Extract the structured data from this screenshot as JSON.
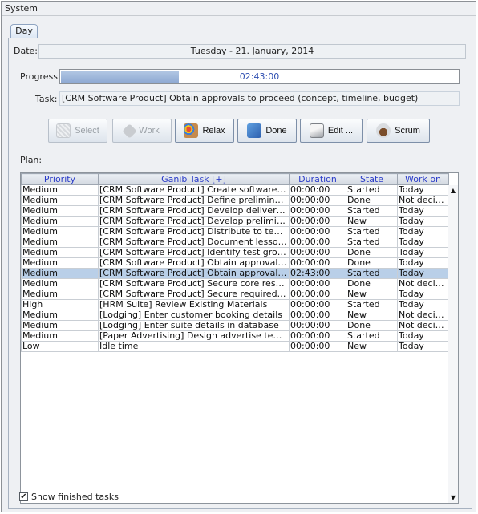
{
  "menu": {
    "system": "System"
  },
  "tab": {
    "label": "Day"
  },
  "date": {
    "label": "Date:",
    "value": "Tuesday - 21. January, 2014"
  },
  "progress": {
    "label": "Progress:",
    "value": "02:43:00",
    "fraction": 0.295
  },
  "task": {
    "label": "Task:",
    "value": "[CRM Software Product] Obtain approvals to proceed (concept, timeline, budget)"
  },
  "buttons": [
    {
      "label": "Select",
      "icon": "select-icon",
      "enabled": false
    },
    {
      "label": "Work",
      "icon": "work-icon",
      "enabled": false
    },
    {
      "label": "Relax",
      "icon": "relax-icon",
      "enabled": true
    },
    {
      "label": "Done",
      "icon": "done-icon",
      "enabled": true
    },
    {
      "label": "Edit ...",
      "icon": "edit-icon",
      "enabled": true
    },
    {
      "label": "Scrum",
      "icon": "scrum-icon",
      "enabled": true
    }
  ],
  "plan": {
    "label": "Plan:"
  },
  "table": {
    "headers": [
      "Priority",
      "Ganib Task [+]",
      "Duration",
      "State",
      "Work on"
    ],
    "rows": [
      [
        "Medium",
        "[CRM Software Product] Create software maintenanc...",
        "00:00:00",
        "Started",
        "Today"
      ],
      [
        "Medium",
        "[CRM Software Product] Define preliminary resources",
        "00:00:00",
        "Done",
        "Not decided"
      ],
      [
        "Medium",
        "[CRM Software Product] Develop delivery timeline",
        "00:00:00",
        "Started",
        "Today"
      ],
      [
        "Medium",
        "[CRM Software Product] Develop preliminary budget",
        "00:00:00",
        "New",
        "Today"
      ],
      [
        "Medium",
        "[CRM Software Product] Distribute to team members",
        "00:00:00",
        "Started",
        "Today"
      ],
      [
        "Medium",
        "[CRM Software Product] Document lessons learned",
        "00:00:00",
        "Started",
        "Today"
      ],
      [
        "Medium",
        "[CRM Software Product] Identify test group",
        "00:00:00",
        "Done",
        "Today"
      ],
      [
        "Medium",
        "[CRM Software Product] Obtain approval to proceed",
        "00:00:00",
        "Done",
        "Today"
      ],
      [
        "Medium",
        "[CRM Software Product] Obtain approvals to proceed ...",
        "02:43:00",
        "Started",
        "Today"
      ],
      [
        "Medium",
        "[CRM Software Product] Secure core resources",
        "00:00:00",
        "Done",
        "Not decided"
      ],
      [
        "Medium",
        "[CRM Software Product] Secure required resources",
        "00:00:00",
        "New",
        "Today"
      ],
      [
        "High",
        "[HRM Suite] Review Existing Materials",
        "00:00:00",
        "Started",
        "Today"
      ],
      [
        "Medium",
        "[Lodging] Enter customer booking details",
        "00:00:00",
        "New",
        "Not decided"
      ],
      [
        "Medium",
        "[Lodging] Enter suite details in database",
        "00:00:00",
        "Done",
        "Not decided"
      ],
      [
        "Medium",
        "[Paper Advertising] Design advertise templates",
        "00:00:00",
        "Started",
        "Today"
      ],
      [
        "Low",
        "Idle time",
        "00:00:00",
        "New",
        "Today"
      ]
    ],
    "selected_row": 8
  },
  "footer": {
    "show_finished_label": "Show finished tasks",
    "show_finished_checked": true
  }
}
